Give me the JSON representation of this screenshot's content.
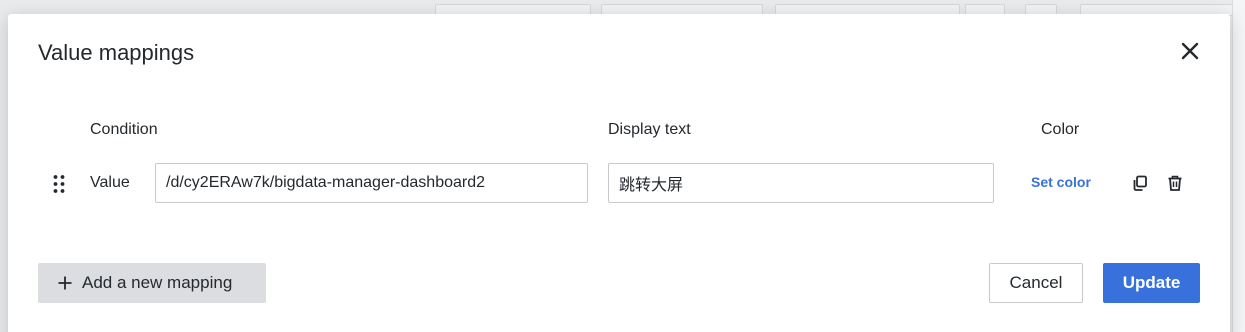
{
  "dialog": {
    "title": "Value mappings"
  },
  "columns": {
    "condition": "Condition",
    "display_text": "Display text",
    "color": "Color"
  },
  "mappings": [
    {
      "type_label": "Value",
      "condition_value": "/d/cy2ERAw7k/bigdata-manager-dashboard2",
      "display_text": "跳转大屏",
      "color_action": "Set color"
    }
  ],
  "footer": {
    "add_label": "Add a new mapping",
    "cancel_label": "Cancel",
    "update_label": "Update"
  },
  "colors": {
    "primary": "#3871dc",
    "secondary_button": "#dcdde0",
    "text": "#24292e"
  },
  "icons": {
    "close": "close-icon",
    "drag": "drag-handle-icon",
    "duplicate": "copy-icon",
    "delete": "trash-icon",
    "add": "plus-icon"
  }
}
